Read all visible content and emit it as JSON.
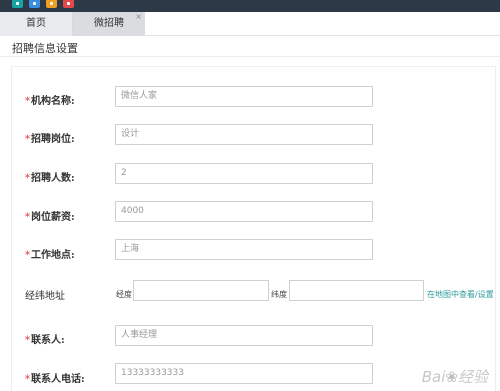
{
  "topbar": {
    "icons": [
      {
        "name": "app-icon-1",
        "color": "#1aa3a3"
      },
      {
        "name": "app-icon-2",
        "color": "#3a8de0"
      },
      {
        "name": "app-icon-3",
        "color": "#f0a020"
      },
      {
        "name": "app-icon-4",
        "color": "#e04a4a"
      }
    ]
  },
  "tabs": {
    "home": "首页",
    "active": "微招聘",
    "close": "×"
  },
  "page": {
    "title": "招聘信息设置"
  },
  "form": {
    "required_mark": "*",
    "org_name": {
      "label": "机构名称:",
      "value": "微信人家"
    },
    "position": {
      "label": "招聘岗位:",
      "value": "设计"
    },
    "headcount": {
      "label": "招聘人数:",
      "value": "2"
    },
    "salary": {
      "label": "岗位薪资:",
      "value": "4000"
    },
    "location": {
      "label": "工作地点:",
      "value": "上海"
    },
    "coords": {
      "label": "经纬地址",
      "longitude_label": "经度",
      "latitude_label": "纬度",
      "longitude_value": "",
      "latitude_value": "",
      "map_link": "在地图中查看/设置"
    },
    "contact": {
      "label": "联系人:",
      "value": "人事经理"
    },
    "phone": {
      "label": "联系人电话:",
      "value": "13333333333"
    }
  },
  "watermark": {
    "text": "Bai",
    "text2": "经验"
  }
}
